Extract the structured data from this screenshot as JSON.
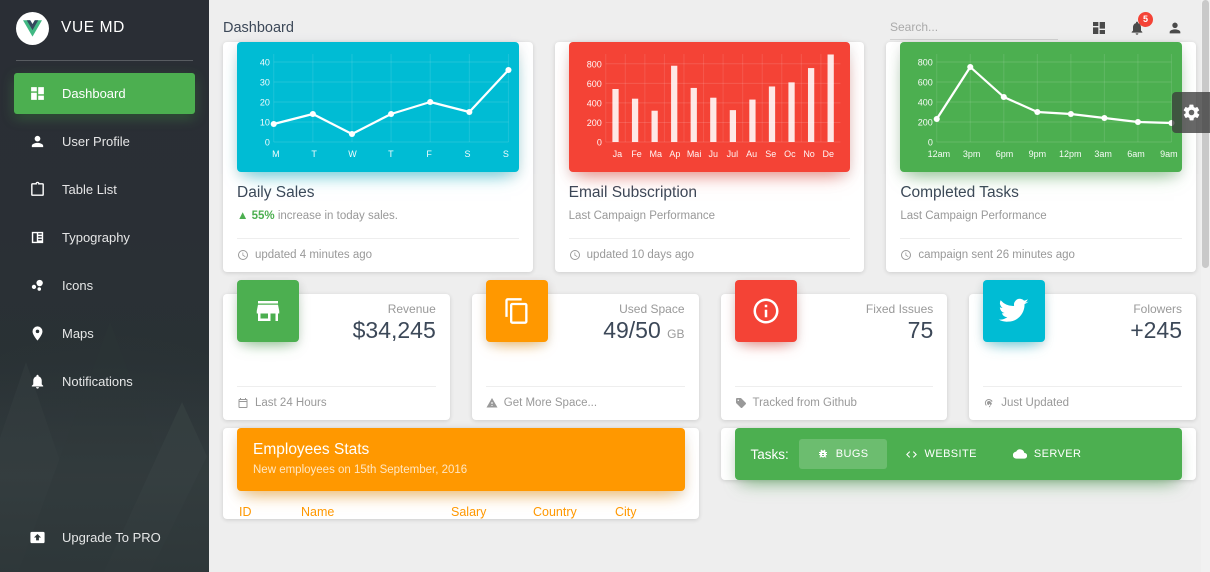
{
  "sidebar": {
    "brand": {
      "name": "VUE MD",
      "logo_icon": "vue-logo-icon"
    },
    "items": [
      {
        "label": "Dashboard",
        "icon": "dashboard-grid-icon",
        "active": true
      },
      {
        "label": "User Profile",
        "icon": "person-icon",
        "active": false
      },
      {
        "label": "Table List",
        "icon": "clipboard-icon",
        "active": false
      },
      {
        "label": "Typography",
        "icon": "typography-icon",
        "active": false
      },
      {
        "label": "Icons",
        "icon": "bubble-chart-icon",
        "active": false
      },
      {
        "label": "Maps",
        "icon": "map-pin-icon",
        "active": false
      },
      {
        "label": "Notifications",
        "icon": "bell-icon",
        "active": false
      }
    ],
    "upgrade": {
      "label": "Upgrade To PRO",
      "icon": "unarchive-icon"
    }
  },
  "topbar": {
    "title": "Dashboard",
    "search": {
      "placeholder": "Search...",
      "value": ""
    },
    "dashboard_icon": "dashboard-grid-icon",
    "notifications_icon": "bell-icon",
    "notifications_count": "5",
    "account_icon": "person-icon",
    "settings_icon": "gear-icon"
  },
  "colors": {
    "green": "#4caf50",
    "teal": "#00bcd4",
    "red": "#f44336",
    "orange": "#ff9800",
    "text": "#3c4858",
    "muted": "#999999"
  },
  "chart_cards": [
    {
      "color": "teal",
      "title": "Daily Sales",
      "subtitle_prefix": "55%",
      "subtitle": "increase in today sales.",
      "subtitle_icon": "arrow-up-icon",
      "footer": "updated 4 minutes ago",
      "footer_icon": "clock-icon"
    },
    {
      "color": "red",
      "title": "Email Subscription",
      "subtitle": "Last Campaign Performance",
      "footer": "updated 10 days ago",
      "footer_icon": "clock-icon"
    },
    {
      "color": "green",
      "title": "Completed Tasks",
      "subtitle": "Last Campaign Performance",
      "footer": "campaign sent 26 minutes ago",
      "footer_icon": "clock-icon"
    }
  ],
  "chart_data": [
    {
      "type": "line",
      "title": "Daily Sales",
      "categories": [
        "M",
        "T",
        "W",
        "T",
        "F",
        "S",
        "S"
      ],
      "values": [
        9,
        14,
        4,
        14,
        20,
        15,
        36
      ],
      "yticks": [
        0,
        10,
        20,
        30,
        40
      ],
      "ylim": [
        0,
        44
      ],
      "xlabel": "",
      "ylabel": "",
      "grid": true,
      "series_color": "#ffffff",
      "plot_bg": "#00bcd4",
      "legend": "none"
    },
    {
      "type": "bar",
      "title": "Email Subscription",
      "categories": [
        "Ja",
        "Fe",
        "Ma",
        "Ap",
        "Mai",
        "Ju",
        "Jul",
        "Au",
        "Se",
        "Oc",
        "No",
        "De"
      ],
      "values": [
        542,
        443,
        320,
        780,
        553,
        453,
        326,
        434,
        568,
        610,
        756,
        895
      ],
      "yticks": [
        0,
        200,
        400,
        600,
        800
      ],
      "ylim": [
        0,
        900
      ],
      "xlabel": "",
      "ylabel": "",
      "grid": true,
      "series_color": "#ffffff",
      "plot_bg": "#f44336",
      "legend": "none"
    },
    {
      "type": "line",
      "title": "Completed Tasks",
      "categories": [
        "12am",
        "3pm",
        "6pm",
        "9pm",
        "12pm",
        "3am",
        "6am",
        "9am"
      ],
      "values": [
        230,
        750,
        450,
        300,
        280,
        240,
        200,
        190
      ],
      "yticks": [
        0,
        200,
        400,
        600,
        800
      ],
      "ylim": [
        0,
        880
      ],
      "xlabel": "",
      "ylabel": "",
      "grid": true,
      "series_color": "#ffffff",
      "plot_bg": "#4caf50",
      "legend": "none"
    }
  ],
  "stat_cards": [
    {
      "color": "green",
      "icon": "store-icon",
      "label": "Revenue",
      "value": "$34,245",
      "unit": "",
      "footer": "Last 24 Hours",
      "footer_icon": "calendar-icon",
      "footer_warn": false
    },
    {
      "color": "orange",
      "icon": "content-copy-icon",
      "label": "Used Space",
      "value": "49/50",
      "unit": "GB",
      "footer": "Get More Space...",
      "footer_icon": "warning-icon",
      "footer_warn": true
    },
    {
      "color": "red",
      "icon": "info-outline-icon",
      "label": "Fixed Issues",
      "value": "75",
      "unit": "",
      "footer": "Tracked from Github",
      "footer_icon": "tag-icon",
      "footer_warn": false
    },
    {
      "color": "teal",
      "icon": "twitter-icon",
      "label": "Folowers",
      "value": "+245",
      "unit": "",
      "footer": "Just Updated",
      "footer_icon": "refresh-icon",
      "footer_warn": false
    }
  ],
  "employees": {
    "title": "Employees Stats",
    "subtitle": "New employees on 15th September, 2016",
    "columns": [
      "ID",
      "Name",
      "Salary",
      "Country",
      "City"
    ]
  },
  "tasks": {
    "label": "Tasks:",
    "tabs": [
      {
        "label": "BUGS",
        "icon": "bug-icon",
        "active": true
      },
      {
        "label": "WEBSITE",
        "icon": "code-icon",
        "active": false
      },
      {
        "label": "SERVER",
        "icon": "cloud-icon",
        "active": false
      }
    ]
  }
}
